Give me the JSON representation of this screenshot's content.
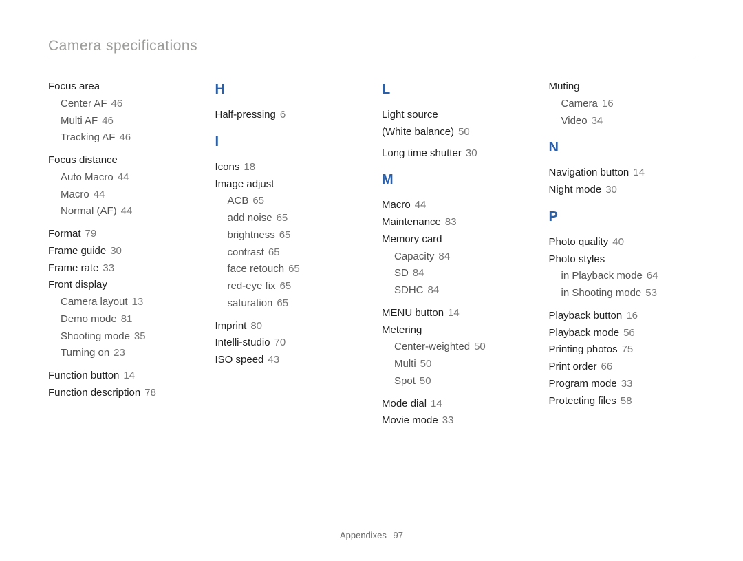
{
  "header": "Camera specifications",
  "footer": {
    "label": "Appendixes",
    "page": "97"
  },
  "col1": {
    "focus_area": {
      "label": "Focus area",
      "items": [
        {
          "label": "Center AF",
          "pg": "46"
        },
        {
          "label": "Multi AF",
          "pg": "46"
        },
        {
          "label": "Tracking AF",
          "pg": "46"
        }
      ]
    },
    "focus_distance": {
      "label": "Focus distance",
      "items": [
        {
          "label": "Auto Macro",
          "pg": "44"
        },
        {
          "label": "Macro",
          "pg": "44"
        },
        {
          "label": "Normal (AF)",
          "pg": "44"
        }
      ]
    },
    "format": {
      "label": "Format",
      "pg": "79"
    },
    "frame_guide": {
      "label": "Frame guide",
      "pg": "30"
    },
    "frame_rate": {
      "label": "Frame rate",
      "pg": "33"
    },
    "front_display": {
      "label": "Front display",
      "items": [
        {
          "label": "Camera layout",
          "pg": "13"
        },
        {
          "label": "Demo mode",
          "pg": "81"
        },
        {
          "label": "Shooting mode",
          "pg": "35"
        },
        {
          "label": "Turning on",
          "pg": "23"
        }
      ]
    },
    "function_button": {
      "label": "Function button",
      "pg": "14"
    },
    "function_description": {
      "label": "Function description",
      "pg": "78"
    }
  },
  "col2": {
    "H": "H",
    "half_pressing": {
      "label": "Half-pressing",
      "pg": "6"
    },
    "I": "I",
    "icons": {
      "label": "Icons",
      "pg": "18"
    },
    "image_adjust": {
      "label": "Image adjust",
      "items": [
        {
          "label": "ACB",
          "pg": "65"
        },
        {
          "label": "add noise",
          "pg": "65"
        },
        {
          "label": "brightness",
          "pg": "65"
        },
        {
          "label": "contrast",
          "pg": "65"
        },
        {
          "label": "face retouch",
          "pg": "65"
        },
        {
          "label": "red-eye fix",
          "pg": "65"
        },
        {
          "label": "saturation",
          "pg": "65"
        }
      ]
    },
    "imprint": {
      "label": "Imprint",
      "pg": "80"
    },
    "intelli_studio": {
      "label": "Intelli-studio",
      "pg": "70"
    },
    "iso_speed": {
      "label": "ISO speed",
      "pg": "43"
    }
  },
  "col3": {
    "L": "L",
    "light_source_l1": "Light source",
    "light_source_l2": {
      "label": "(White balance)",
      "pg": "50"
    },
    "long_time_shutter": {
      "label": "Long time shutter",
      "pg": "30"
    },
    "M": "M",
    "macro": {
      "label": "Macro",
      "pg": "44"
    },
    "maintenance": {
      "label": "Maintenance",
      "pg": "83"
    },
    "memory_card": {
      "label": "Memory card",
      "items": [
        {
          "label": "Capacity",
          "pg": "84"
        },
        {
          "label": "SD",
          "pg": "84"
        },
        {
          "label": "SDHC",
          "pg": "84"
        }
      ]
    },
    "menu_button": {
      "label": "MENU button",
      "pg": "14"
    },
    "metering": {
      "label": "Metering",
      "items": [
        {
          "label": "Center-weighted",
          "pg": "50"
        },
        {
          "label": "Multi",
          "pg": "50"
        },
        {
          "label": "Spot",
          "pg": "50"
        }
      ]
    },
    "mode_dial": {
      "label": "Mode dial",
      "pg": "14"
    },
    "movie_mode": {
      "label": "Movie mode",
      "pg": "33"
    }
  },
  "col4": {
    "muting": {
      "label": "Muting",
      "items": [
        {
          "label": "Camera",
          "pg": "16"
        },
        {
          "label": "Video",
          "pg": "34"
        }
      ]
    },
    "N": "N",
    "navigation_button": {
      "label": "Navigation button",
      "pg": "14"
    },
    "night_mode": {
      "label": "Night mode",
      "pg": "30"
    },
    "P": "P",
    "photo_quality": {
      "label": "Photo quality",
      "pg": "40"
    },
    "photo_styles": {
      "label": "Photo styles",
      "items": [
        {
          "label": "in Playback mode",
          "pg": "64"
        },
        {
          "label": "in Shooting mode",
          "pg": "53"
        }
      ]
    },
    "playback_button": {
      "label": "Playback button",
      "pg": "16"
    },
    "playback_mode": {
      "label": "Playback mode",
      "pg": "56"
    },
    "printing_photos": {
      "label": "Printing photos",
      "pg": "75"
    },
    "print_order": {
      "label": "Print order",
      "pg": "66"
    },
    "program_mode": {
      "label": "Program mode",
      "pg": "33"
    },
    "protecting_files": {
      "label": "Protecting files",
      "pg": "58"
    }
  }
}
